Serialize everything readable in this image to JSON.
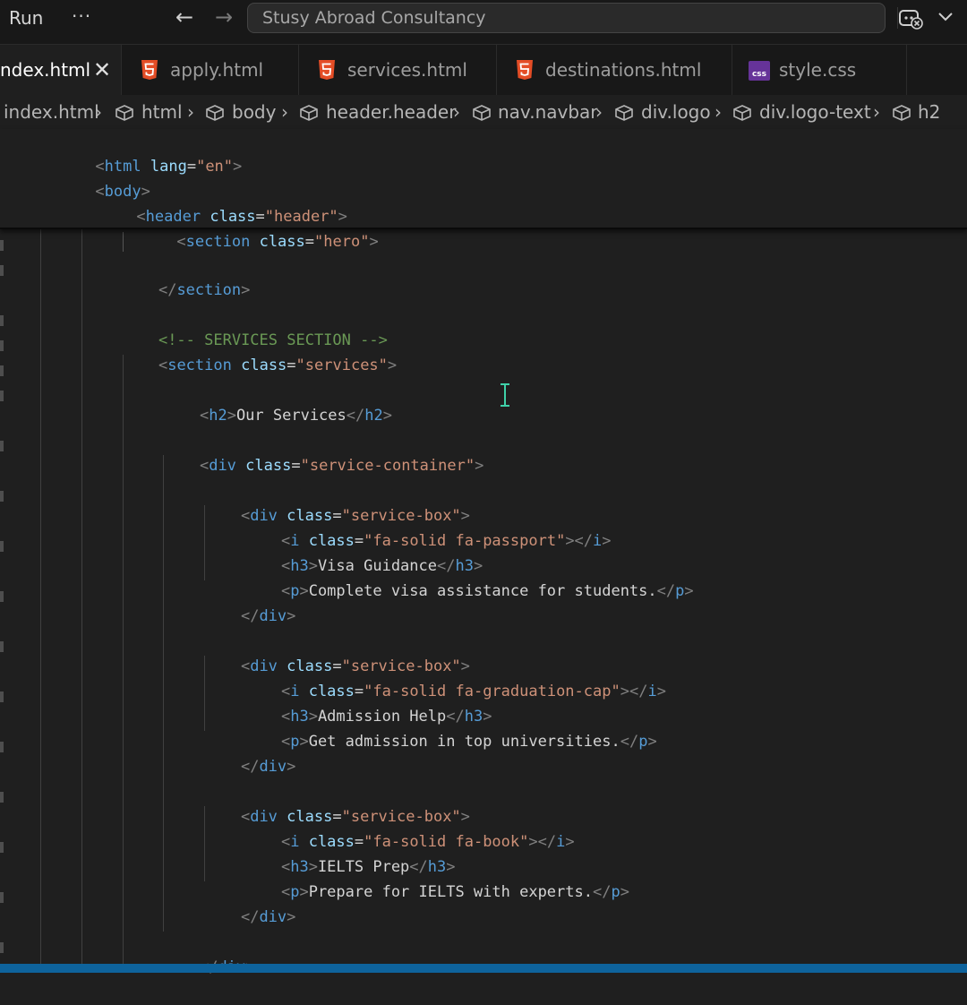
{
  "titlebar": {
    "run_label": "Run",
    "more_label": "···",
    "back_glyph": "←",
    "forward_glyph": "→",
    "search_text": "Stusy Abroad Consultancy"
  },
  "tabs": [
    {
      "label": "ndex.html",
      "icon": "close-icon",
      "active": true
    },
    {
      "label": "apply.html",
      "icon": "html5-icon"
    },
    {
      "label": "services.html",
      "icon": "html5-icon"
    },
    {
      "label": "destinations.html",
      "icon": "html5-icon"
    },
    {
      "label": "style.css",
      "icon": "css-icon"
    }
  ],
  "breadcrumb": [
    "index.html",
    "html",
    "body",
    "header.header",
    "nav.navbar",
    "div.logo",
    "div.logo-text",
    "h2"
  ],
  "sticky_lines": [
    "<html lang=\"en\">",
    "<body>",
    "<header class=\"header\">",
    "<section class=\"hero\">"
  ],
  "code_lines": [
    "",
    "</section>",
    "",
    "<!-- SERVICES SECTION -->",
    "<section class=\"services\">",
    "",
    "<h2>Our Services</h2>",
    "",
    "<div class=\"service-container\">",
    "",
    "<div class=\"service-box\">",
    "<i class=\"fa-solid fa-passport\"></i>",
    "<h3>Visa Guidance</h3>",
    "<p>Complete visa assistance for students.</p>",
    "</div>",
    "",
    "<div class=\"service-box\">",
    "<i class=\"fa-solid fa-graduation-cap\"></i>",
    "<h3>Admission Help</h3>",
    "<p>Get admission in top universities.</p>",
    "</div>",
    "",
    "<div class=\"service-box\">",
    "<i class=\"fa-solid fa-book\"></i>",
    "<h3>IELTS Prep</h3>",
    "<p>Prepare for IELTS with experts.</p>",
    "</div>",
    "",
    "</div>"
  ],
  "colors": {
    "tag_bracket": "#808080",
    "tag_name": "#569cd6",
    "attribute": "#9cdcfe",
    "string": "#ce9178",
    "comment": "#6a9955",
    "text": "#d4d4d4",
    "html5_icon": "#e44d26",
    "css_icon": "#663399",
    "statusbar": "#0e639c"
  }
}
